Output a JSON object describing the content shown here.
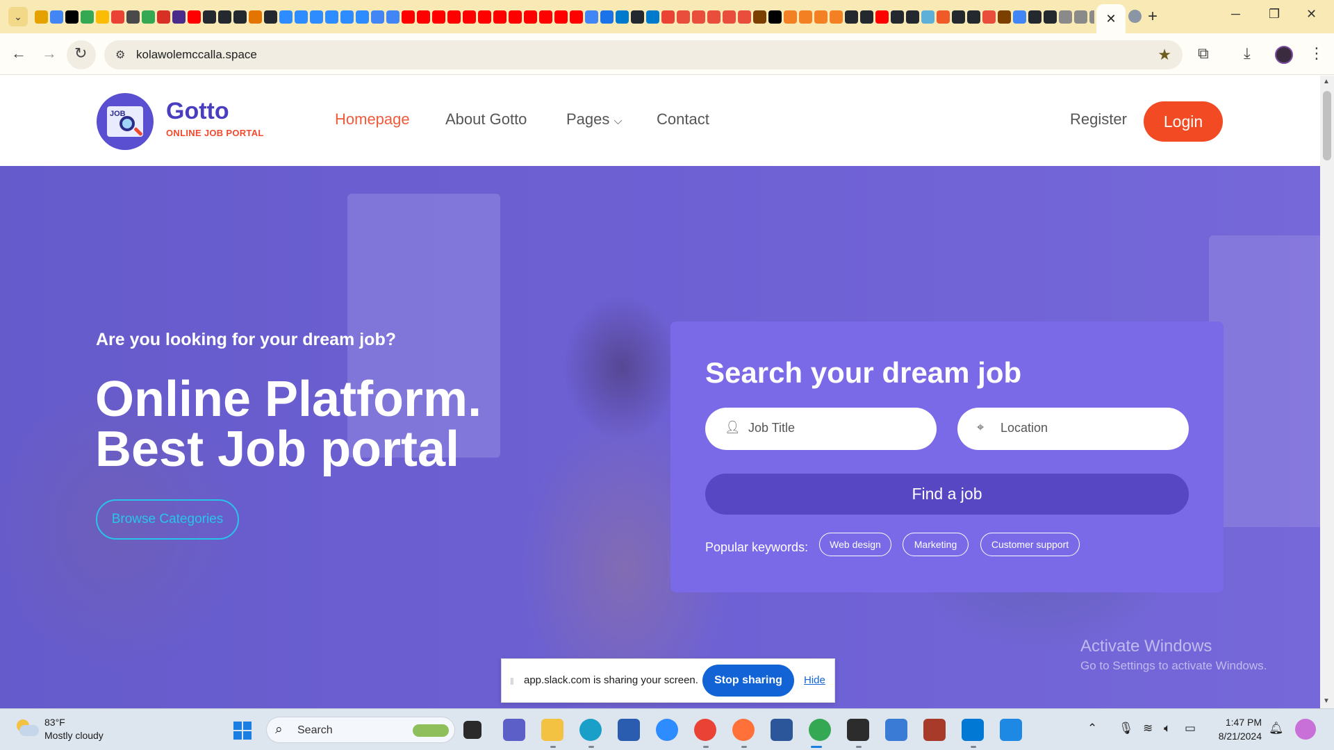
{
  "browser": {
    "url": "kolawolemccalla.space",
    "tab_close": "✕",
    "new_tab": "+",
    "favicon_colors": [
      "#e5a100",
      "#4285f4",
      "#000000",
      "#34a853",
      "#fbbc05",
      "#ea4335",
      "#4a4a4a",
      "#34a853",
      "#d93025",
      "#4a2c8a",
      "#ff0000",
      "#24292f",
      "#24292f",
      "#24292f",
      "#e37400",
      "#24292f",
      "#2d8cff",
      "#2d8cff",
      "#2d8cff",
      "#2d8cff",
      "#2d8cff",
      "#2d8cff",
      "#4285f4",
      "#4285f4",
      "#ff0000",
      "#ff0000",
      "#ff0000",
      "#ff0000",
      "#ff0000",
      "#ff0000",
      "#ff0000",
      "#ff0000",
      "#ff0000",
      "#ff0000",
      "#ff0000",
      "#ff0000",
      "#4285f4",
      "#1a73e8",
      "#007acc",
      "#24292f",
      "#007acc",
      "#ea4335",
      "#e94e3d",
      "#e94e3d",
      "#e94e3d",
      "#e94e3d",
      "#e94e3d",
      "#7b3f00",
      "#000000",
      "#f48024",
      "#f48024",
      "#f48024",
      "#f48024",
      "#24292f",
      "#24292f",
      "#ff0000",
      "#24292f",
      "#24292f",
      "#5fb0d8",
      "#f05a28",
      "#24292f",
      "#24292f",
      "#e94e3d",
      "#7b3f00",
      "#4285f4",
      "#24292f",
      "#24292f",
      "#8a8a8a",
      "#8a8a8a",
      "#8a8a8a",
      "#8a8a8a",
      "#8a8a8a",
      "#f05133"
    ]
  },
  "header": {
    "brand": "Gotto",
    "tagline": "ONLINE JOB PORTAL",
    "logo_text": "JOB",
    "nav": [
      {
        "label": "Homepage"
      },
      {
        "label": "About Gotto"
      },
      {
        "label": "Pages"
      },
      {
        "label": "Contact"
      }
    ],
    "register": "Register",
    "login": "Login"
  },
  "hero": {
    "subtitle": "Are you looking for your dream job?",
    "title_line1": "Online Platform.",
    "title_line2": "Best Job portal",
    "browse_button": "Browse Categories"
  },
  "search_card": {
    "title": "Search your dream job",
    "job_title_placeholder": "Job Title",
    "location_placeholder": "Location",
    "find_button": "Find a job",
    "popular_label": "Popular keywords:",
    "keywords": [
      "Web design",
      "Marketing",
      "Customer support"
    ]
  },
  "activate_windows": {
    "line1": "Activate Windows",
    "line2": "Go to Settings to activate Windows."
  },
  "share_bar": {
    "text": "app.slack.com is sharing your screen.",
    "stop": "Stop sharing",
    "hide": "Hide"
  },
  "taskbar": {
    "temperature": "83°F",
    "condition": "Mostly cloudy",
    "search_label": "Search",
    "time": "1:47 PM",
    "date": "8/21/2024"
  },
  "colors": {
    "brand_purple": "#4a3ec0",
    "accent_orange": "#f24a22",
    "hero_overlay": "#6b5fd4",
    "card_bg": "#7a6ae8",
    "find_button": "#5747c2",
    "browse_cyan": "#28c4ea"
  }
}
